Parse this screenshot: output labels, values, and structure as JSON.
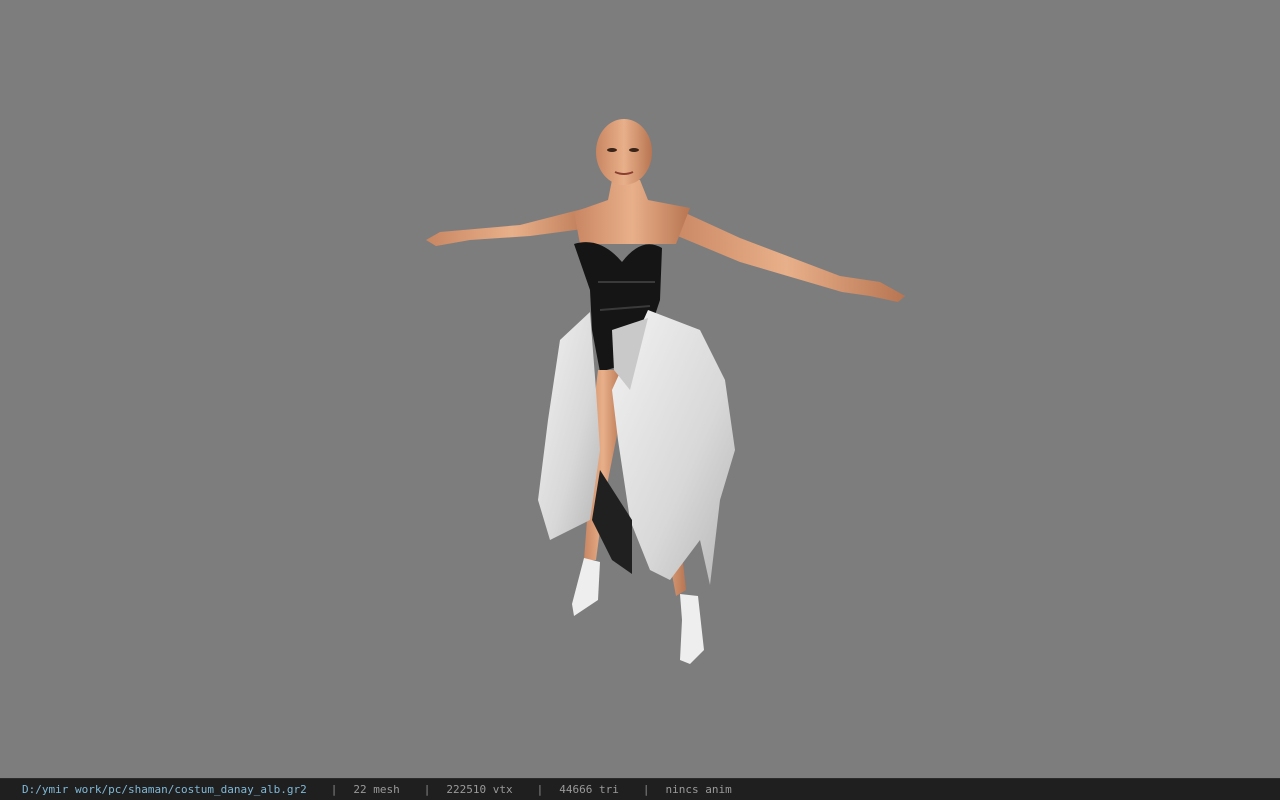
{
  "viewer": {
    "background": "#7d7d7d",
    "model_description_icon": "character-model-3d"
  },
  "status": {
    "path": "D:/ymir work/pc/shaman/costum_danay_alb.gr2",
    "separator": "|",
    "mesh": "22 mesh",
    "vtx": "222510 vtx",
    "tri": "44666 tri",
    "anim": "nincs anim"
  }
}
